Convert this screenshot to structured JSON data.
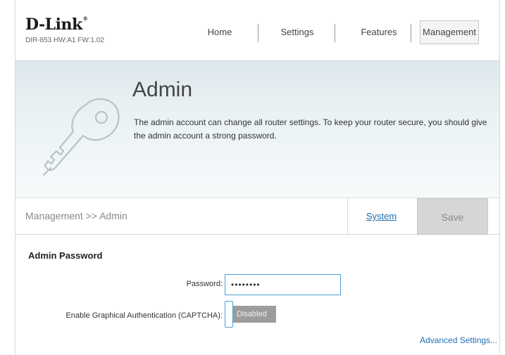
{
  "header": {
    "brand": "D-Link",
    "brand_mark": "®",
    "model_info": "DIR-853 HW:A1 FW:1.02",
    "nav": {
      "home": "Home",
      "settings": "Settings",
      "features": "Features",
      "management": "Management"
    },
    "active_nav": "Management"
  },
  "banner": {
    "title": "Admin",
    "description": "The admin account can change all router settings. To keep your router secure, you should give the admin account a strong password.",
    "icon": "key-icon"
  },
  "breadcrumb": {
    "path": "Management >> Admin",
    "system_link": "System",
    "save_label": "Save"
  },
  "admin_password": {
    "section_title": "Admin Password",
    "password_label": "Password:",
    "password_value": "••••••••",
    "captcha_label": "Enable Graphical Authentication (CAPTCHA):",
    "captcha_state": "Disabled",
    "advanced_link": "Advanced Settings..."
  },
  "colors": {
    "link": "#1f6fb2",
    "input_border": "#4aa0d5",
    "toggle_off": "#9c9c9c",
    "banner_bg": "#dde8ec"
  }
}
